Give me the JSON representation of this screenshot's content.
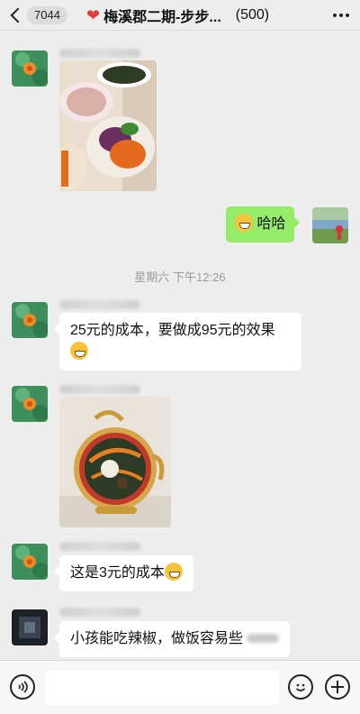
{
  "header": {
    "unread_count": "7044",
    "title": "梅溪郡二期-步步...",
    "member_count": "(500)"
  },
  "timestamp": "星期六 下午12:26",
  "messages": {
    "mine_text": "哈哈",
    "msg1_text": "25元的成本，要做成95元的效果",
    "msg2_text": "这是3元的成本",
    "msg3_text": "小孩能吃辣椒，做饭容易些"
  },
  "icons": {
    "back": "chevron-left-icon",
    "more": "more-icon",
    "voice": "voice-icon",
    "emoji": "emoji-icon",
    "add": "plus-icon"
  },
  "colors": {
    "bg": "#ededed",
    "mine_bubble": "#95ec69",
    "other_bubble": "#ffffff",
    "heart": "#e23b3b"
  }
}
